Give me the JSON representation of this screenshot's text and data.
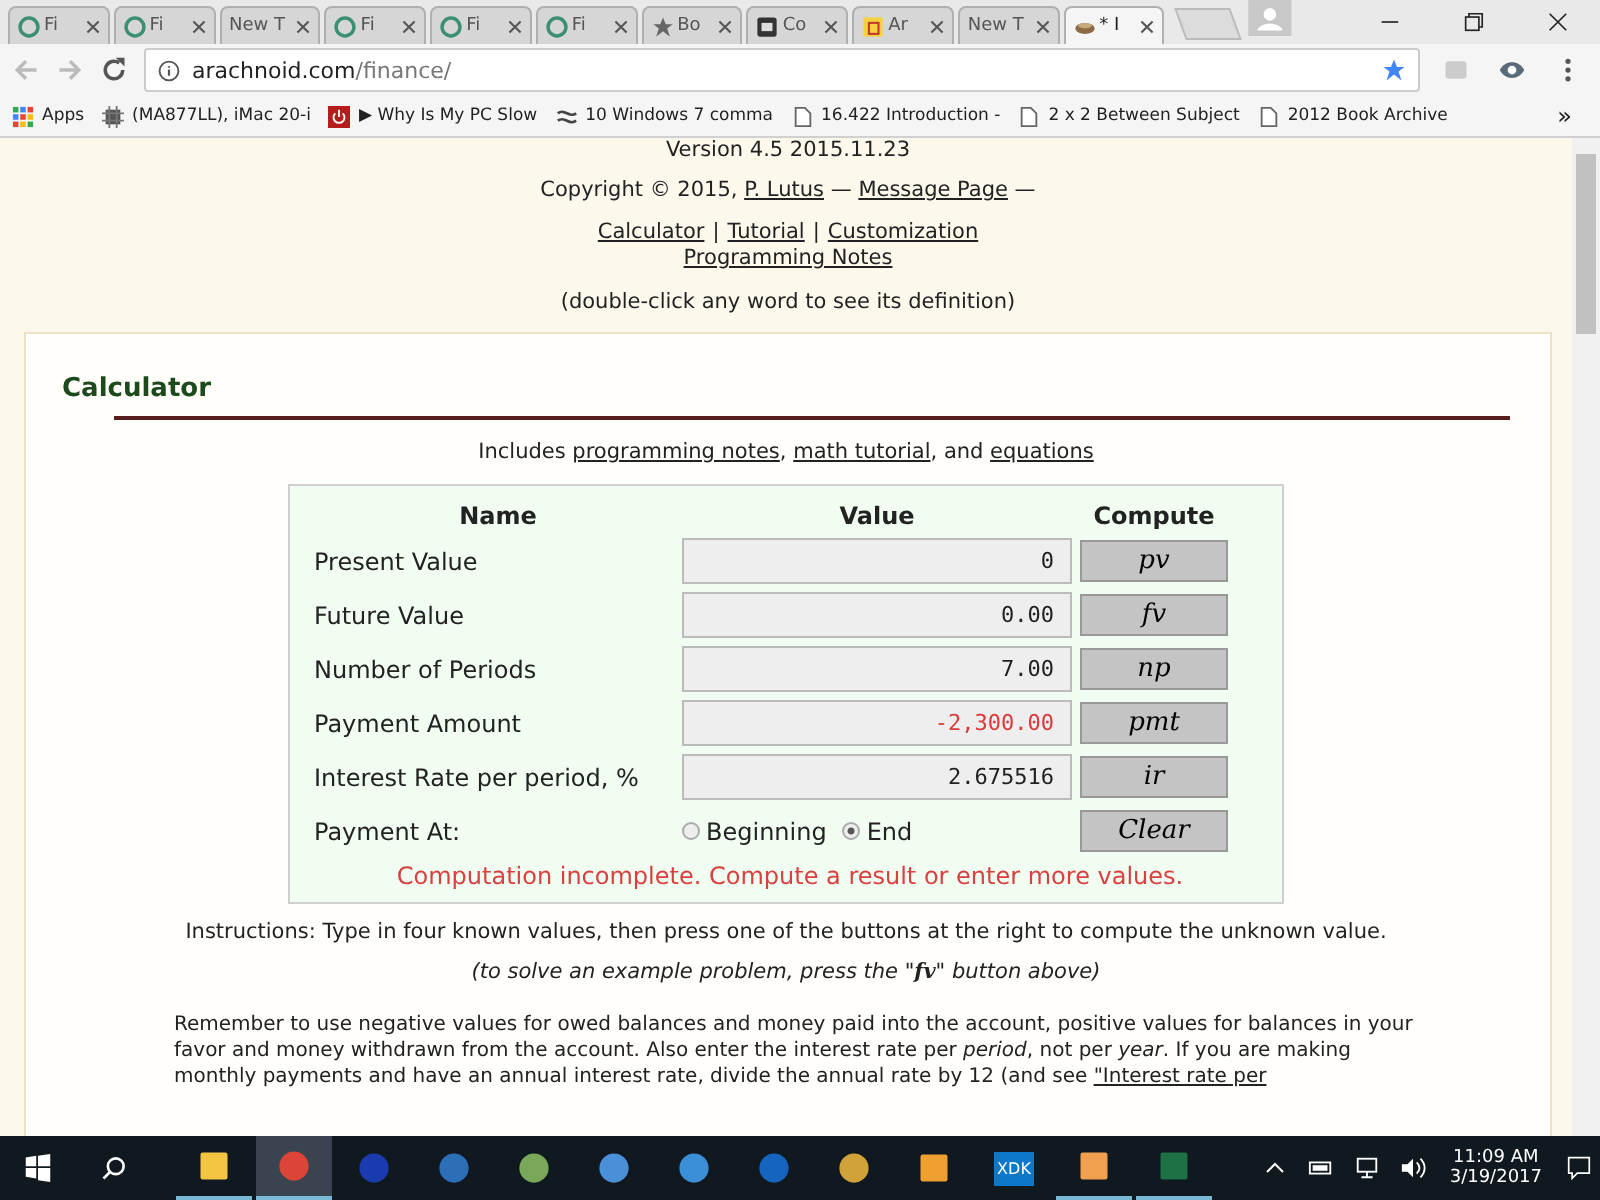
{
  "browser": {
    "tabs": [
      {
        "title": "Fi",
        "kind": "circle",
        "selected": false
      },
      {
        "title": "Fi",
        "kind": "circle",
        "selected": false
      },
      {
        "title": "New T",
        "kind": "none",
        "selected": false
      },
      {
        "title": "Fi",
        "kind": "circle",
        "selected": false
      },
      {
        "title": "Fi",
        "kind": "circle",
        "selected": false
      },
      {
        "title": "Fi",
        "kind": "circle",
        "selected": false
      },
      {
        "title": "Bo",
        "kind": "star",
        "selected": false
      },
      {
        "title": "Co",
        "kind": "cs",
        "selected": false
      },
      {
        "title": "Ar",
        "kind": "letter",
        "selected": false
      },
      {
        "title": "New T",
        "kind": "none",
        "selected": false
      },
      {
        "title": "* I",
        "kind": "bowl",
        "selected": true
      }
    ],
    "url": {
      "host": "arachnoid.com",
      "path": "/finance/"
    },
    "bookmarks": [
      {
        "title": "Apps",
        "kind": "grid"
      },
      {
        "title": "(MA877LL), iMac 20-i",
        "kind": "chip"
      },
      {
        "title": "▶ Why Is My PC Slow",
        "kind": "power"
      },
      {
        "title": "10 Windows 7 comma",
        "kind": "swirl"
      },
      {
        "title": "16.422 Introduction -",
        "kind": "page"
      },
      {
        "title": "2 x 2 Between Subject",
        "kind": "page"
      },
      {
        "title": "2012 Book Archive",
        "kind": "page"
      }
    ],
    "more": "»"
  },
  "page": {
    "version": "Version 4.5 2015.11.23",
    "copyright": [
      {
        "text": "Copyright © 2015, ",
        "link": false
      },
      {
        "text": "P. Lutus",
        "link": true
      },
      {
        "text": " — ",
        "link": false
      },
      {
        "text": "Message Page",
        "link": true
      },
      {
        "text": " —",
        "link": false
      }
    ],
    "nav": [
      "Calculator",
      "Tutorial",
      "Customization"
    ],
    "nav_separator": "|",
    "nav2": "Programming Notes",
    "hint": "(double-click any word to see its definition)",
    "section_title": "Calculator",
    "includes": [
      {
        "text": "Includes ",
        "link": false
      },
      {
        "text": "programming notes",
        "link": true
      },
      {
        "text": ", ",
        "link": false
      },
      {
        "text": "math tutorial",
        "link": true
      },
      {
        "text": ", and ",
        "link": false
      },
      {
        "text": "equations",
        "link": true
      }
    ],
    "calculator": {
      "columns": [
        "Name",
        "Value",
        "Compute"
      ],
      "rows": [
        {
          "name": "Present Value",
          "value": "0",
          "negative": false,
          "button": "pv"
        },
        {
          "name": "Future Value",
          "value": "0.00",
          "negative": false,
          "button": "fv"
        },
        {
          "name": "Number of Periods",
          "value": "7.00",
          "negative": false,
          "button": "np"
        },
        {
          "name": "Payment Amount",
          "value": "-2,300.00",
          "negative": true,
          "button": "pmt"
        },
        {
          "name": "Interest Rate per period, %",
          "value": "2.675516",
          "negative": false,
          "button": "ir"
        }
      ],
      "payment_at": {
        "label": "Payment At:",
        "options": [
          {
            "label": "Beginning",
            "selected": false
          },
          {
            "label": "End",
            "selected": true
          }
        ],
        "button": "Clear"
      },
      "message": "Computation incomplete. Compute a result or enter more values."
    },
    "instructions": "Instructions: Type in four known values, then press one of the buttons at the right to compute the unknown value.",
    "example": "(to solve an example problem, press the \"**fv**\" button above)",
    "remember": [
      {
        "text": "Remember to use negative values for owed balances and money paid into the account, positive values for balances in your favor and money withdrawn from the account. Also enter the interest rate per *period*, not per *year*. If you are making monthly payments and have an annual interest rate, divide the annual rate by 12 (and see ",
        "link": false
      },
      {
        "text": "\"Interest rate per",
        "link": true
      }
    ]
  },
  "taskbar": {
    "apps": [
      {
        "kind": "folder",
        "running": true,
        "selected": false
      },
      {
        "kind": "chrome",
        "running": true,
        "selected": true
      },
      {
        "kind": "disc",
        "running": false,
        "selected": false
      },
      {
        "kind": "mail",
        "running": false,
        "selected": false
      },
      {
        "kind": "photos",
        "running": false,
        "selected": false
      },
      {
        "kind": "arrows",
        "running": false,
        "selected": false
      },
      {
        "kind": "key",
        "running": false,
        "selected": false
      },
      {
        "kind": "m",
        "running": false,
        "selected": false
      },
      {
        "kind": "magnifier",
        "running": false,
        "selected": false
      },
      {
        "kind": "doc",
        "running": false,
        "selected": false
      },
      {
        "kind": "xdk",
        "running": false,
        "selected": false
      },
      {
        "kind": "clock",
        "running": true,
        "selected": false
      },
      {
        "kind": "sheet",
        "running": true,
        "selected": false
      }
    ],
    "xdk": "XDK",
    "time": "11:09 AM",
    "date": "3/19/2017"
  }
}
